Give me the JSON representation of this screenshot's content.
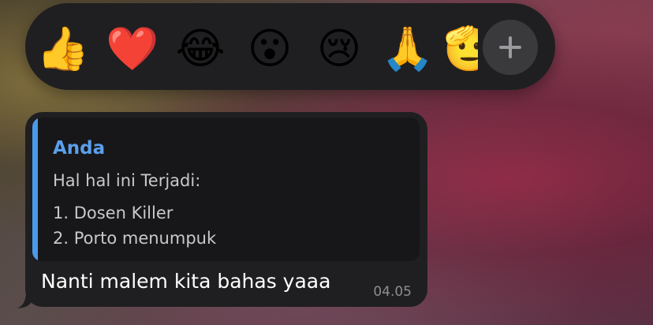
{
  "reactions": {
    "emojis": [
      {
        "char": "👍",
        "name": "thumbs-up"
      },
      {
        "char": "❤️",
        "name": "red-heart"
      },
      {
        "char": "😂",
        "name": "face-with-tears-of-joy"
      },
      {
        "char": "😮",
        "name": "face-with-open-mouth"
      },
      {
        "char": "😢",
        "name": "crying-face"
      },
      {
        "char": "🙏",
        "name": "folded-hands"
      },
      {
        "char": "🫡",
        "name": "saluting-face"
      }
    ],
    "add_icon": "plus-icon"
  },
  "message": {
    "quote": {
      "author": "Anda",
      "lines": [
        "Hal hal ini Terjadi:",
        "1. Dosen Killer",
        "2. Porto menumpuk"
      ]
    },
    "text": "Nanti malem kita bahas yaaa",
    "time": "04.05"
  },
  "colors": {
    "bubble": "#1f1f21",
    "quote_background": "#171719",
    "quote_accent": "#4b9ae8",
    "author": "#5aa0ec",
    "timestamp": "#8e8e93"
  }
}
